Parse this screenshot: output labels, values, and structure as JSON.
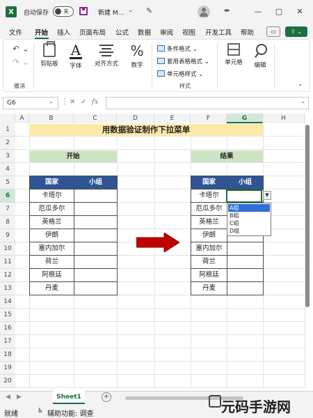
{
  "titlebar": {
    "autosave_label": "自动保存",
    "toggle_state": "关",
    "doc_title": "新建 M...",
    "chevron": "⌄",
    "min": "—",
    "max": "▢",
    "close": "✕"
  },
  "tabs": [
    "文件",
    "开始",
    "插入",
    "页面布局",
    "公式",
    "数据",
    "审阅",
    "视图",
    "开发工具",
    "帮助"
  ],
  "ribbon": {
    "undo_label": "撤消",
    "clipboard_label": "剪贴板",
    "font_label": "字体",
    "align_label": "对齐方式",
    "number_label": "数字",
    "cond_format": "条件格式",
    "table_format": "套用表格格式",
    "cell_style": "单元格样式",
    "styles_group": "样式",
    "cells_label": "单元格",
    "edit_label": "编辑"
  },
  "formula_bar": {
    "namebox": "G6",
    "fx": "fx"
  },
  "grid": {
    "columns": [
      "A",
      "B",
      "C",
      "D",
      "E",
      "F",
      "G",
      "H"
    ],
    "selected_column": "G",
    "rows": [
      "1",
      "2",
      "3",
      "4",
      "5",
      "6",
      "7",
      "8",
      "9",
      "10",
      "11",
      "12",
      "13",
      "14",
      "15",
      "16",
      "17",
      "18",
      "19",
      "20"
    ],
    "selected_row": "6"
  },
  "sheet": {
    "title": "用数据验证制作下拉菜单",
    "left_label": "开始",
    "right_label": "结果",
    "header_country": "国家",
    "header_group": "小组",
    "countries": [
      "卡塔尔",
      "厄瓜多尔",
      "英格兰",
      "伊朗",
      "塞内加尔",
      "荷兰",
      "阿根廷",
      "丹麦"
    ]
  },
  "dropdown": {
    "options": [
      "A组",
      "B组",
      "C组",
      "D组"
    ],
    "highlighted": "A组"
  },
  "sheet_tabs": {
    "active": "Sheet1",
    "add": "+"
  },
  "status": {
    "ready": "就绪",
    "accessibility": "辅助功能: 调查"
  },
  "watermark": "元码手游网",
  "colors": {
    "excel_green": "#1d6f42",
    "header_blue": "#2f5597",
    "title_yellow": "#fde9a8",
    "label_green": "#cde4c4",
    "arrow_red": "#c00000"
  }
}
